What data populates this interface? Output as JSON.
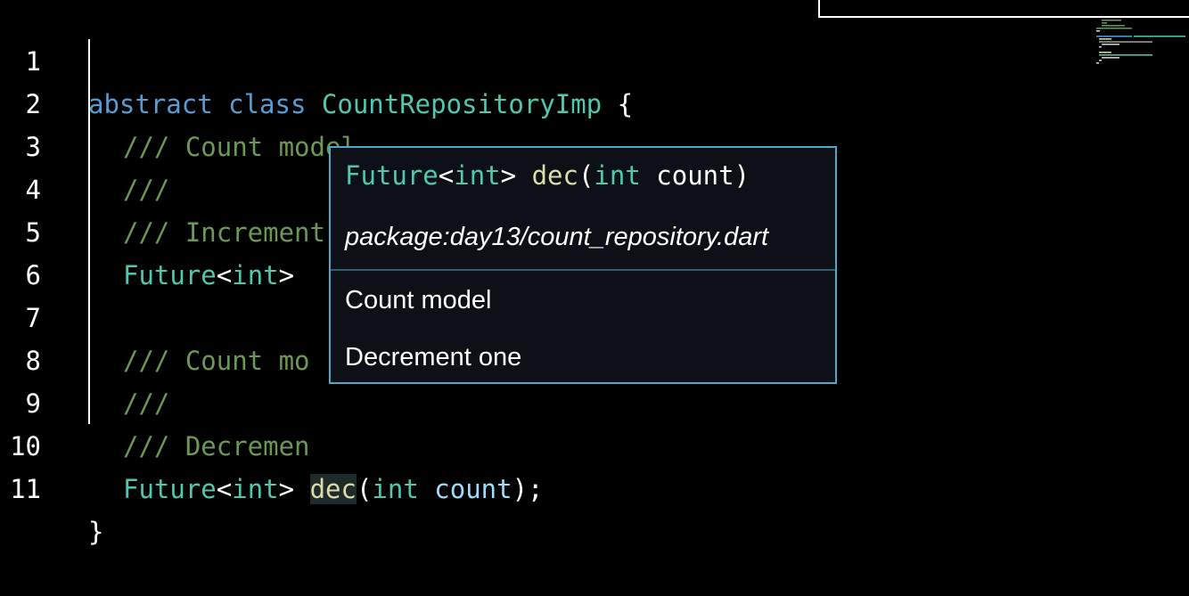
{
  "editor": {
    "line_numbers": [
      "1",
      "2",
      "3",
      "4",
      "5",
      "6",
      "7",
      "8",
      "9",
      "10",
      "11"
    ],
    "line1": {
      "kw": "abstract class",
      "cls": "CountRepositoryImp",
      "brace": "{"
    },
    "line2": "/// Count model",
    "line3": "///",
    "line4": "/// Increment one",
    "line5": {
      "type": "Future",
      "lt": "<",
      "generic": "int",
      "gt": ">"
    },
    "line7": "/// Count mo",
    "line8": "///",
    "line9": "/// Decremen",
    "line10": {
      "type": "Future",
      "lt": "<",
      "generic": "int",
      "gt": ">",
      "fn": "dec",
      "open": "(",
      "ptype": "int",
      "pname": "count",
      "close": ");"
    },
    "line11": "}"
  },
  "hover": {
    "sig_type": "Future",
    "sig_lt": "<",
    "sig_generic": "int",
    "sig_gt": ">",
    "sig_fn": "dec",
    "sig_open": "(",
    "sig_ptype": "int",
    "sig_pname": "count",
    "sig_close": ")",
    "package": "package:day13/count_repository.dart",
    "doc_line1": "Count model",
    "doc_line2": "Decrement one"
  }
}
